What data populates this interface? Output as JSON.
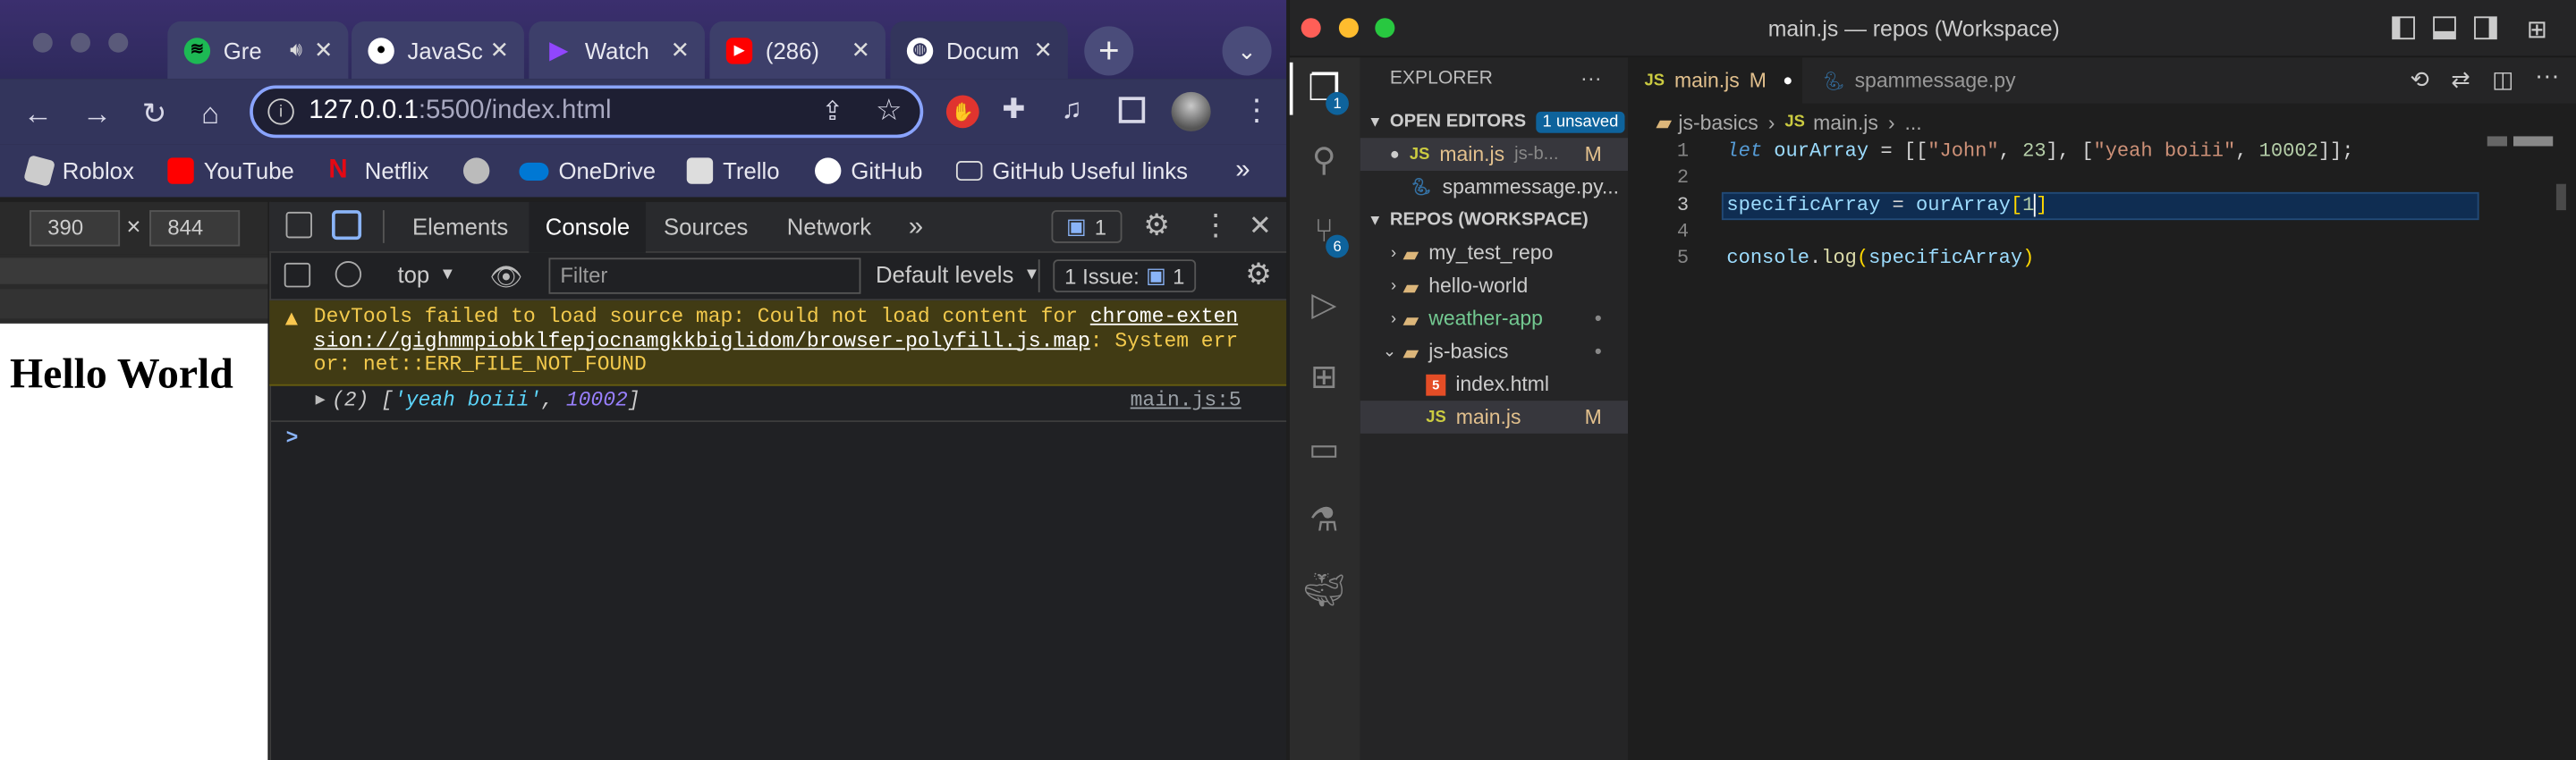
{
  "browser": {
    "tabs": [
      {
        "label": "Gre",
        "icon": "spotify-icon",
        "color": "#1db954"
      },
      {
        "label": "JavaSc",
        "icon": "github-icon",
        "color": "#ffffff"
      },
      {
        "label": "Watch",
        "icon": "play-icon",
        "color": "#9146ff"
      },
      {
        "label": "(286)",
        "icon": "youtube-icon",
        "color": "#ff0000"
      },
      {
        "label": "Docum",
        "icon": "globe-icon",
        "color": "#ffffff"
      }
    ],
    "url_host": "127.0.0.1",
    "url_rest": ":5500/index.html",
    "bookmarks": [
      {
        "label": "Roblox",
        "color": "#dddddd"
      },
      {
        "label": "YouTube",
        "color": "#ff0000"
      },
      {
        "label": "Netflix",
        "color": "#e50914"
      },
      {
        "label": "OneDrive",
        "color": "#0078d4"
      },
      {
        "label": "Trello",
        "color": "#dddddd"
      },
      {
        "label": "GitHub",
        "color": "#ffffff"
      },
      {
        "label": "GitHub Useful links",
        "color": "#dddddd"
      }
    ],
    "more_bookmarks": "»",
    "device_width": "390",
    "device_height": "844",
    "dim_x": "×",
    "page_heading": "Hello World"
  },
  "devtools": {
    "tabs": [
      "Elements",
      "Console",
      "Sources",
      "Network"
    ],
    "more_tabs": "»",
    "msg_count": "1",
    "context": "top",
    "filter_placeholder": "Filter",
    "levels": "Default levels",
    "issues": "1 Issue:",
    "issues_count": "1",
    "warning_prefix": "DevTools failed to load source map: Could not load content for ",
    "warning_link": "chrome-extension://gighmmpiobklfepjocnamgkkbiglidom/browser-polyfill.js.map",
    "warning_suffix": ": System error: net::ERR_FILE_NOT_FOUND",
    "log_count": "(2)",
    "log_str": "'yeah boiii'",
    "log_num": "10002",
    "log_source": "main.js:5",
    "prompt": ">"
  },
  "vscode": {
    "title": "main.js — repos (Workspace)",
    "explorer_label": "EXPLORER",
    "explorer_more": "···",
    "open_editors": "OPEN EDITORS",
    "unsaved": "1 unsaved",
    "open_files": [
      {
        "name": "main.js",
        "dir": "js-b...",
        "status": "M",
        "lang": "JS"
      },
      {
        "name": "spammessage.py...",
        "dir": "",
        "status": "",
        "lang": "PY"
      }
    ],
    "workspace": "REPOS (WORKSPACE)",
    "folders": [
      {
        "name": "my_test_repo",
        "status": ""
      },
      {
        "name": "hello-world",
        "status": ""
      },
      {
        "name": "weather-app",
        "status": "•"
      },
      {
        "name": "js-basics",
        "status": "•"
      }
    ],
    "files": [
      {
        "name": "index.html",
        "status": "",
        "lang": "HTML"
      },
      {
        "name": "main.js",
        "status": "M",
        "lang": "JS"
      }
    ],
    "editor_tabs": [
      {
        "name": "main.js",
        "status": "M",
        "lang": "JS"
      },
      {
        "name": "spammessage.py",
        "status": "",
        "lang": "PY"
      }
    ],
    "breadcrumb": [
      "js-basics",
      "main.js",
      "..."
    ],
    "source_control_badge": "6",
    "explorer_badge": "1",
    "line_numbers": [
      "1",
      "2",
      "3",
      "4",
      "5"
    ],
    "code": {
      "l1_kw": "let",
      "l1_var": "ourArray",
      "l1_eq": " = [[",
      "l1_s1": "\"John\"",
      "l1_c1": ", ",
      "l1_n1": "23",
      "l1_c2": "], [",
      "l1_s2": "\"yeah boiii\"",
      "l1_c3": ", ",
      "l1_n2": "10002",
      "l1_end": "]];",
      "l3_a": "specificArray",
      "l3_b": " = ",
      "l3_c": "ourArray",
      "l3_d": "[",
      "l3_e": "1",
      "l3_f": "]",
      "l5_a": "console",
      "l5_b": ".",
      "l5_c": "log",
      "l5_d": "(",
      "l5_e": "specificArray",
      "l5_f": ")"
    }
  }
}
